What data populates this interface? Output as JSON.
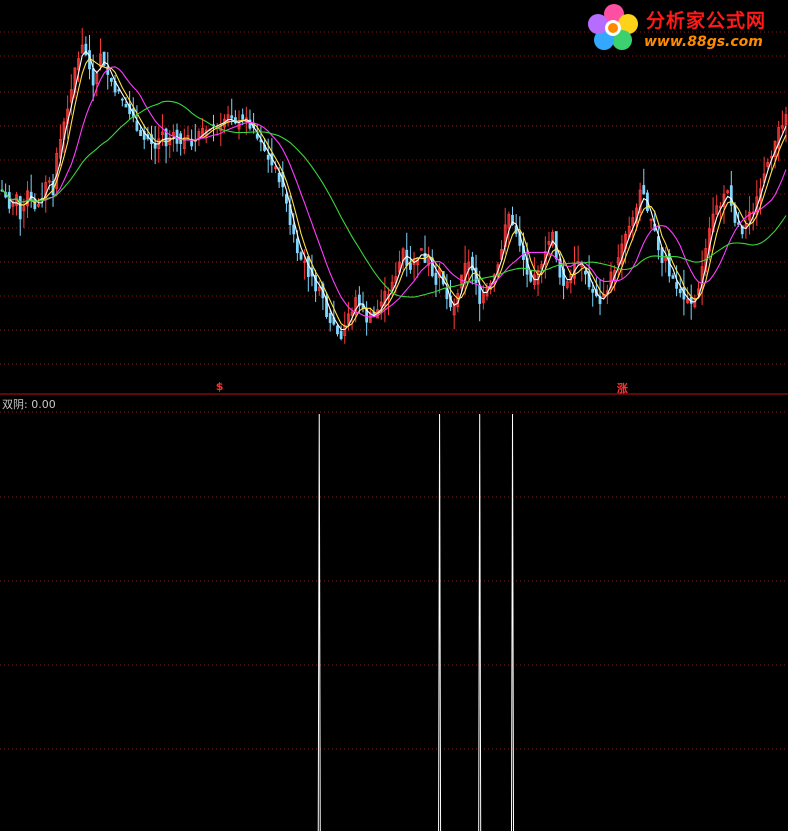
{
  "watermark": {
    "cn": "分析家公式网",
    "url": "www.88gs.com"
  },
  "indicator": {
    "label": "双阴: 0.00"
  },
  "signals": {
    "buy_label": "$",
    "rise_label": "涨"
  },
  "colors": {
    "background": "#000000",
    "up_candle": "#ff3b3b",
    "down_candle": "#7fd7ff",
    "ma_short": "#ffffff",
    "ma_mid": "#ffe24a",
    "ma_long": "#ff3cff",
    "ma_longest": "#39d63b",
    "grid": "#8a1a1a",
    "divider": "#c01010",
    "spike": "#ffffff"
  },
  "chart_data": [
    {
      "type": "candlestick",
      "title": "",
      "series_note": "price panel with moving averages",
      "price_path": [
        205,
        200,
        190,
        195,
        200,
        185,
        195,
        205,
        200,
        190,
        195,
        200,
        210,
        215,
        205,
        230,
        245,
        260,
        270,
        280,
        300,
        310,
        320,
        310,
        300,
        290,
        300,
        310,
        305,
        295,
        290,
        285,
        280,
        275,
        270,
        265,
        260,
        255,
        250,
        245,
        245,
        240,
        238,
        245,
        250,
        240,
        245,
        250,
        245,
        240,
        248,
        244,
        242,
        245,
        248,
        250,
        252,
        254,
        256,
        255,
        258,
        260,
        262,
        258,
        255,
        260,
        262,
        258,
        255,
        250,
        245,
        240,
        235,
        230,
        225,
        220,
        215,
        205,
        195,
        180,
        170,
        160,
        150,
        150,
        140,
        135,
        130,
        128,
        120,
        110,
        105,
        100,
        96,
        92,
        100,
        105,
        110,
        120,
        118,
        110,
        105,
        110,
        105,
        112,
        118,
        122,
        125,
        130,
        140,
        150,
        160,
        150,
        145,
        150,
        155,
        158,
        150,
        155,
        140,
        135,
        140,
        130,
        120,
        110,
        115,
        125,
        135,
        145,
        150,
        142,
        130,
        120,
        125,
        130,
        135,
        140,
        150,
        160,
        175,
        185,
        180,
        170,
        160,
        150,
        140,
        130,
        135,
        140,
        150,
        160,
        165,
        170,
        150,
        140,
        130,
        135,
        140,
        150,
        148,
        145,
        140,
        130,
        125,
        120,
        118,
        122,
        130,
        138,
        145,
        150,
        160,
        170,
        175,
        180,
        190,
        205,
        200,
        185,
        180,
        170,
        160,
        150,
        155,
        140,
        135,
        130,
        125,
        120,
        118,
        115,
        120,
        130,
        145,
        160,
        175,
        185,
        190,
        195,
        200,
        205,
        190,
        180,
        175,
        172,
        178,
        185,
        190,
        200,
        210,
        220,
        230,
        235,
        240,
        250,
        255,
        260
      ],
      "moving_averages": [
        "ma_short",
        "ma_mid",
        "ma_long",
        "ma_longest"
      ],
      "signals": [
        {
          "label": "$",
          "index": 60
        },
        {
          "label": "涨",
          "index": 170
        }
      ]
    },
    {
      "type": "bar",
      "title": "",
      "name": "双阴",
      "value": 0.0,
      "spike_indices": [
        87,
        120,
        131,
        140,
        218
      ],
      "ylim": [
        0,
        1
      ]
    }
  ]
}
